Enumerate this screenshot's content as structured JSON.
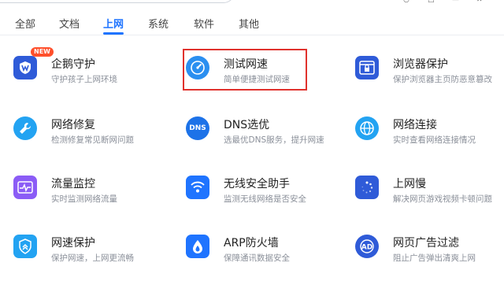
{
  "tabs": [
    {
      "label": "全部"
    },
    {
      "label": "文档"
    },
    {
      "label": "上网"
    },
    {
      "label": "系统"
    },
    {
      "label": "软件"
    },
    {
      "label": "其他"
    }
  ],
  "active_tab": "上网",
  "tools": [
    {
      "title": "企鹅守护",
      "desc": "守护孩子上网环境",
      "icon": "penguin-shield-icon",
      "badge": "NEW",
      "color": "#2f5bd8"
    },
    {
      "title": "测试网速",
      "desc": "简单便捷测试网速",
      "icon": "speedometer-icon",
      "color": "#2b8ff0"
    },
    {
      "title": "浏览器保护",
      "desc": "保护浏览器主页防恶意篡改",
      "icon": "browser-lock-icon",
      "color": "#2f5bd8"
    },
    {
      "title": "网络修复",
      "desc": "检测修复常见断网问题",
      "icon": "wrench-globe-icon",
      "color": "#23a3f2"
    },
    {
      "title": "DNS选优",
      "desc": "选最优DNS服务，提升网速",
      "icon": "dns-icon",
      "color": "#1d72e8"
    },
    {
      "title": "网络连接",
      "desc": "实时查看网络连接情况",
      "icon": "globe-icon",
      "color": "#23a3f2"
    },
    {
      "title": "流量监控",
      "desc": "实时监测网络流量",
      "icon": "traffic-monitor-icon",
      "color": "#8b5cf6"
    },
    {
      "title": "无线安全助手",
      "desc": "监测无线网络是否安全",
      "icon": "wifi-shield-icon",
      "color": "#1f74ff"
    },
    {
      "title": "上网慢",
      "desc": "解决网页游戏视频卡顿问题",
      "icon": "loading-icon",
      "color": "#2f5bd8"
    },
    {
      "title": "网速保护",
      "desc": "保护网速，上网更流畅",
      "icon": "speed-shield-icon",
      "color": "#23a3f2"
    },
    {
      "title": "ARP防火墙",
      "desc": "保障通讯数据安全",
      "icon": "firewall-drop-icon",
      "color": "#1f74ff"
    },
    {
      "title": "网页广告过滤",
      "desc": "阻止广告弹出清爽上网",
      "icon": "ad-block-icon",
      "color": "#2f5bd8"
    }
  ]
}
